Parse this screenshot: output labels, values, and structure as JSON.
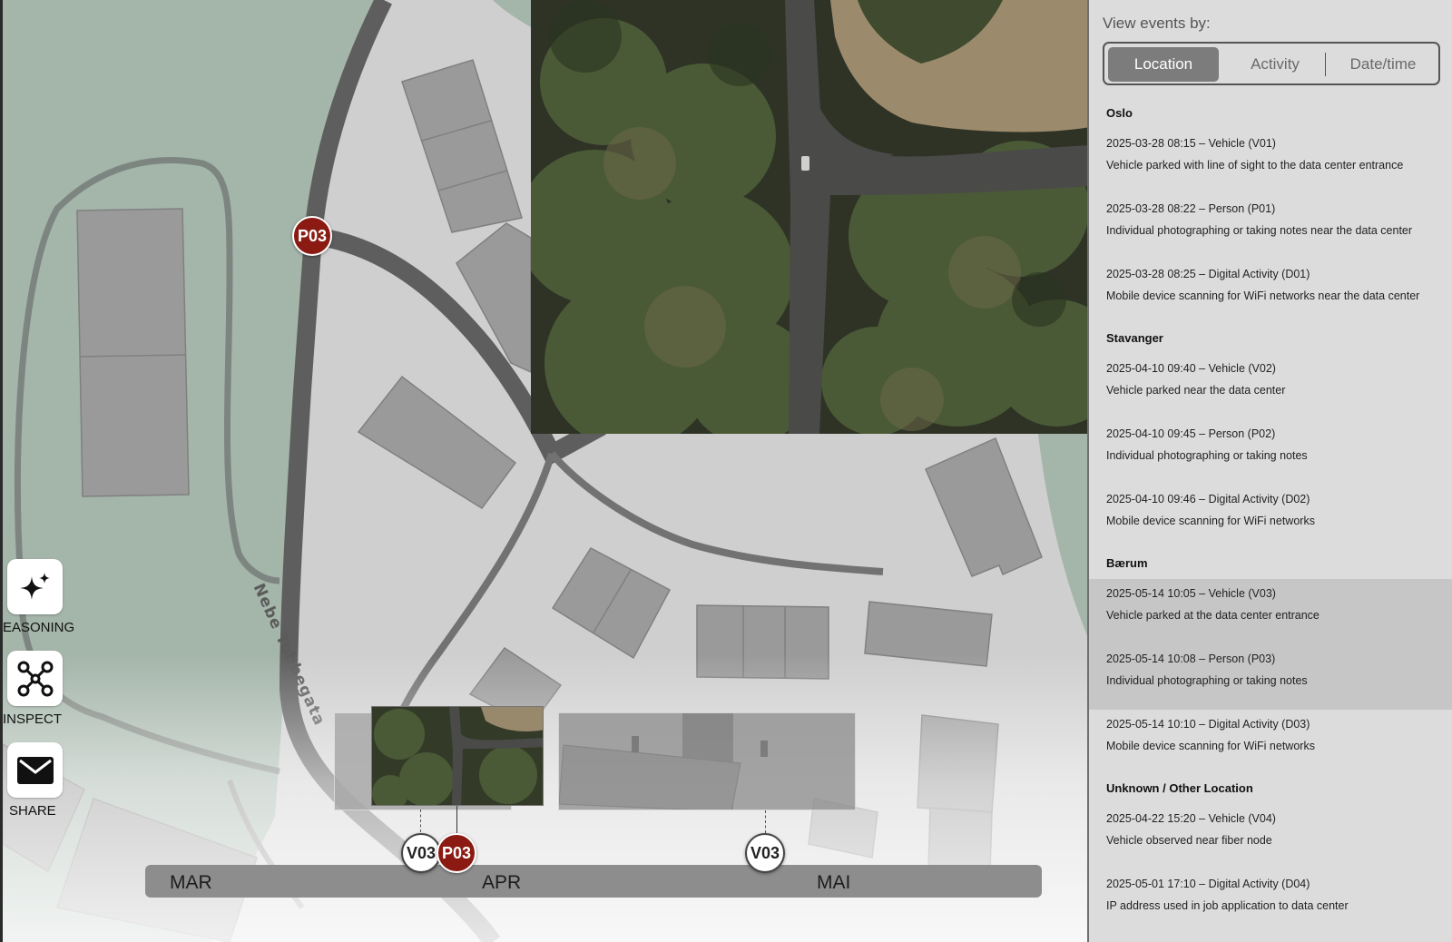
{
  "map": {
    "street_name": "Nebe Tobbegata",
    "markers": [
      {
        "id": "P03",
        "type": "person"
      },
      {
        "id": "V03",
        "type": "vehicle"
      },
      {
        "id": "P03",
        "type": "person"
      },
      {
        "id": "V03",
        "type": "vehicle"
      }
    ],
    "colors": {
      "person_marker": "#8a1a12",
      "vehicle_marker": "#ffffff",
      "green_area": "#9fb3a6",
      "road": "#5e5e5e",
      "building": "#9a9a9a"
    }
  },
  "tools": [
    {
      "label": "EASONING",
      "icon": "sparkle-icon"
    },
    {
      "label": "INSPECT",
      "icon": "graph-nodes-icon"
    },
    {
      "label": "SHARE",
      "icon": "envelope-icon"
    }
  ],
  "timeline": {
    "months": [
      "MAR",
      "APR",
      "MAI"
    ]
  },
  "sidebar": {
    "view_label": "View events by:",
    "tabs": [
      {
        "label": "Location",
        "active": true
      },
      {
        "label": "Activity",
        "active": false
      },
      {
        "label": "Date/time",
        "active": false
      }
    ],
    "groups": [
      {
        "title": "Oslo",
        "events": [
          {
            "head": "2025-03-28 08:15 – Vehicle (V01)",
            "desc": "Vehicle parked with line of sight to the data center entrance",
            "highlight": false
          },
          {
            "head": "2025-03-28 08:22 – Person (P01)",
            "desc": "Individual photographing or taking notes near the data center",
            "highlight": false
          },
          {
            "head": "2025-03-28 08:25 – Digital Activity (D01)",
            "desc": "Mobile device scanning for WiFi networks near the data center",
            "highlight": false
          }
        ]
      },
      {
        "title": "Stavanger",
        "events": [
          {
            "head": "2025-04-10 09:40 – Vehicle (V02)",
            "desc": "Vehicle parked near the data center",
            "highlight": false
          },
          {
            "head": "2025-04-10 09:45 – Person (P02)",
            "desc": "Individual photographing or taking notes",
            "highlight": false
          },
          {
            "head": "2025-04-10 09:46 – Digital Activity (D02)",
            "desc": "Mobile device scanning for WiFi networks",
            "highlight": false
          }
        ]
      },
      {
        "title": "Bærum",
        "events": [
          {
            "head": "2025-05-14 10:05 – Vehicle (V03)",
            "desc": "Vehicle parked at the data center entrance",
            "highlight": true
          },
          {
            "head": "2025-05-14 10:08 – Person (P03)",
            "desc": "Individual photographing or taking notes",
            "highlight": true
          },
          {
            "head": "2025-05-14 10:10 – Digital Activity (D03)",
            "desc": "Mobile device scanning for WiFi networks",
            "highlight": false
          }
        ]
      },
      {
        "title": "Unknown / Other Location",
        "events": [
          {
            "head": "2025-04-22 15:20 – Vehicle (V04)",
            "desc": "Vehicle observed near fiber node",
            "highlight": false
          },
          {
            "head": "2025-05-01 17:10 – Digital Activity (D04)",
            "desc": "IP address used in job application to data center",
            "highlight": false
          }
        ]
      }
    ]
  }
}
